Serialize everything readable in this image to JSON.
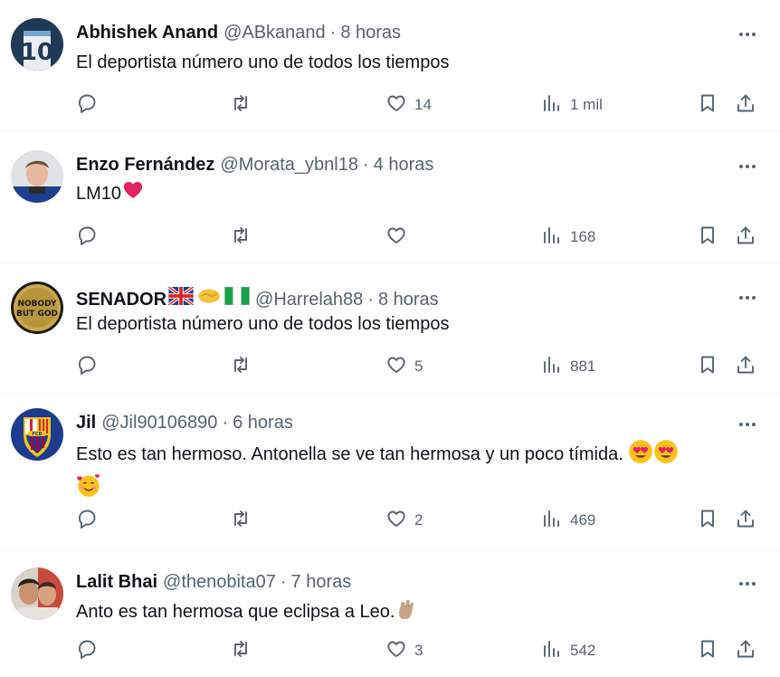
{
  "tweets": [
    {
      "name": "Abhishek Anand",
      "handle": "@ABkanand",
      "time": "8 horas",
      "text": "El deportista número uno de todos los tiempos",
      "likes": "14",
      "views": "1 mil",
      "avatar": "abhishek-avatar"
    },
    {
      "name": "Enzo Fernández",
      "handle": "@Morata_ybnl18",
      "time": "4 horas",
      "text": "LM10",
      "likes": "",
      "views": "168",
      "avatar": "enzo-avatar"
    },
    {
      "name": "SENADOR",
      "handle": "@Harrelah88",
      "time": "8 horas",
      "text": "El deportista número uno de todos los tiempos",
      "likes": "5",
      "views": "881",
      "avatar": "senador-avatar"
    },
    {
      "name": "Jil",
      "handle": "@Jil90106890",
      "time": "6 horas",
      "text": "Esto es tan hermoso. Antonella se ve tan hermosa y un poco tímida.",
      "likes": "2",
      "views": "469",
      "avatar": "fcb-crest-avatar"
    },
    {
      "name": "Lalit Bhai",
      "handle": "@thenobita07",
      "time": "7 horas",
      "text": "Anto es tan hermosa que eclipsa a Leo.",
      "likes": "3",
      "views": "542",
      "avatar": "lalit-avatar"
    }
  ],
  "separator": "·",
  "icons": [
    "reply-icon",
    "retweet-icon",
    "like-icon",
    "views-icon",
    "bookmark-icon",
    "share-icon",
    "more-icon"
  ],
  "colors": {
    "text": "#0f1419",
    "muted": "#536471",
    "border": "#eff3f4",
    "heart": "#e0245e"
  }
}
